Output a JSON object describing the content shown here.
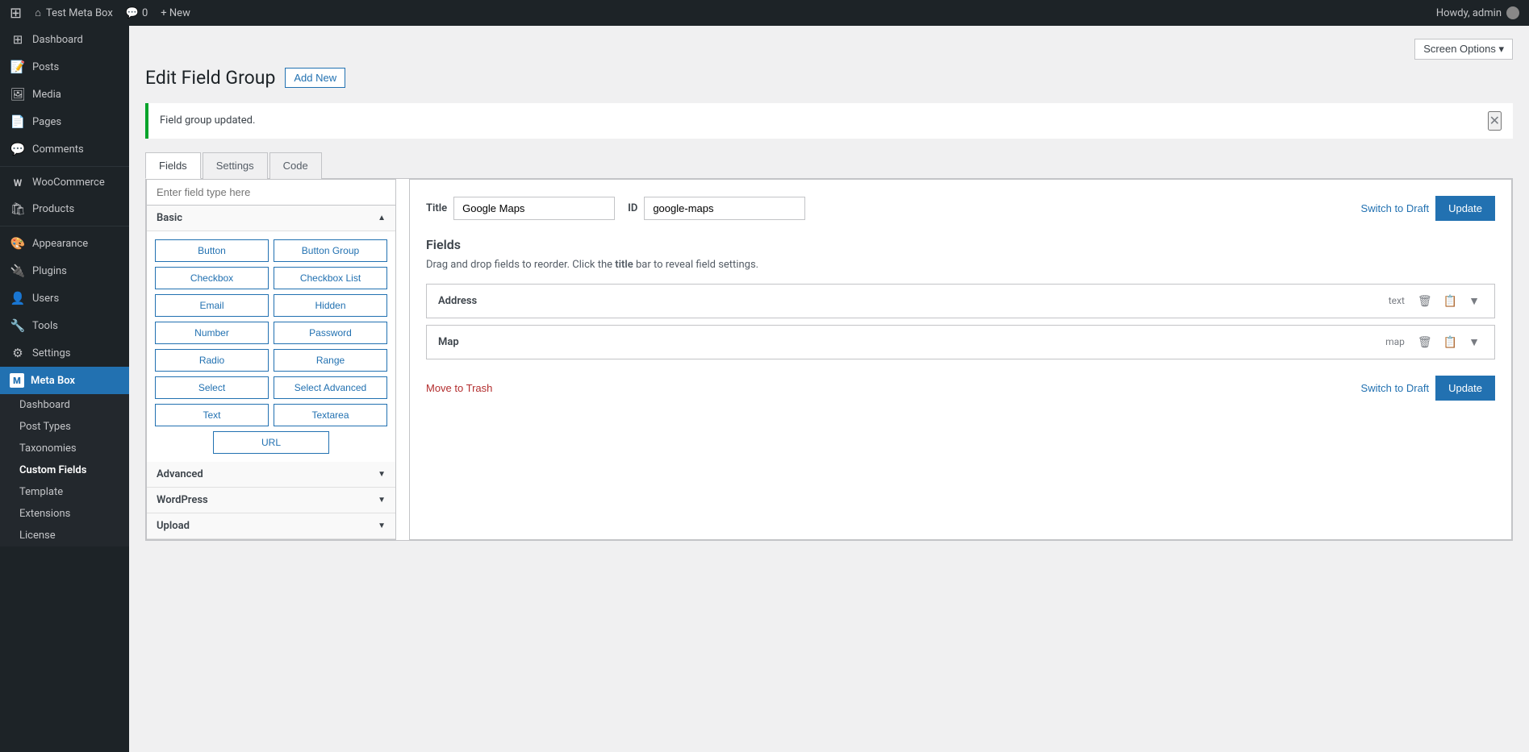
{
  "adminbar": {
    "wp_logo": "⊞",
    "site_name": "Test Meta Box",
    "home_icon": "⌂",
    "comments_icon": "💬",
    "comments_count": "0",
    "new_label": "+ New",
    "howdy": "Howdy, admin"
  },
  "sidebar": {
    "menu_items": [
      {
        "id": "dashboard",
        "label": "Dashboard",
        "icon": "⊞"
      },
      {
        "id": "posts",
        "label": "Posts",
        "icon": "📝"
      },
      {
        "id": "media",
        "label": "Media",
        "icon": "🖼"
      },
      {
        "id": "pages",
        "label": "Pages",
        "icon": "📄"
      },
      {
        "id": "comments",
        "label": "Comments",
        "icon": "💬"
      },
      {
        "id": "woocommerce",
        "label": "WooCommerce",
        "icon": "W"
      },
      {
        "id": "products",
        "label": "Products",
        "icon": "🛍"
      },
      {
        "id": "appearance",
        "label": "Appearance",
        "icon": "🎨"
      },
      {
        "id": "plugins",
        "label": "Plugins",
        "icon": "🔌"
      },
      {
        "id": "users",
        "label": "Users",
        "icon": "👤"
      },
      {
        "id": "tools",
        "label": "Tools",
        "icon": "🔧"
      },
      {
        "id": "settings",
        "label": "Settings",
        "icon": "⚙"
      }
    ],
    "metabox_label": "Meta Box",
    "metabox_m": "M",
    "submenu": [
      {
        "id": "mb-dashboard",
        "label": "Dashboard"
      },
      {
        "id": "post-types",
        "label": "Post Types"
      },
      {
        "id": "taxonomies",
        "label": "Taxonomies"
      },
      {
        "id": "custom-fields",
        "label": "Custom Fields",
        "active": true
      },
      {
        "id": "template",
        "label": "Template"
      },
      {
        "id": "extensions",
        "label": "Extensions"
      },
      {
        "id": "license",
        "label": "License"
      }
    ]
  },
  "screen_options": {
    "label": "Screen Options ▾"
  },
  "page": {
    "title": "Edit Field Group",
    "add_new_label": "Add New"
  },
  "notice": {
    "message": "Field group updated.",
    "close_icon": "✕"
  },
  "tabs": [
    {
      "id": "fields",
      "label": "Fields",
      "active": true
    },
    {
      "id": "settings",
      "label": "Settings"
    },
    {
      "id": "code",
      "label": "Code"
    }
  ],
  "field_type_search": {
    "placeholder": "Enter field type here"
  },
  "basic_section": {
    "label": "Basic",
    "expanded": true,
    "buttons": [
      {
        "id": "button",
        "label": "Button"
      },
      {
        "id": "button-group",
        "label": "Button Group"
      },
      {
        "id": "checkbox",
        "label": "Checkbox"
      },
      {
        "id": "checkbox-list",
        "label": "Checkbox List"
      },
      {
        "id": "email",
        "label": "Email"
      },
      {
        "id": "hidden",
        "label": "Hidden"
      },
      {
        "id": "number",
        "label": "Number"
      },
      {
        "id": "password",
        "label": "Password"
      },
      {
        "id": "radio",
        "label": "Radio"
      },
      {
        "id": "range",
        "label": "Range"
      },
      {
        "id": "select",
        "label": "Select"
      },
      {
        "id": "select-advanced",
        "label": "Select Advanced"
      },
      {
        "id": "text",
        "label": "Text"
      },
      {
        "id": "textarea",
        "label": "Textarea"
      },
      {
        "id": "url",
        "label": "URL",
        "full": true
      }
    ]
  },
  "advanced_section": {
    "label": "Advanced",
    "expanded": false
  },
  "wordpress_section": {
    "label": "WordPress",
    "expanded": false
  },
  "upload_section": {
    "label": "Upload",
    "expanded": false
  },
  "main_panel": {
    "title_label": "Title",
    "title_value": "Google Maps",
    "id_label": "ID",
    "id_value": "google-maps",
    "switch_draft_label": "Switch to Draft",
    "update_label": "Update",
    "fields_heading": "Fields",
    "fields_help": "Drag and drop fields to reorder. Click the title bar to reveal field settings.",
    "fields_help_bold": "title",
    "field_rows": [
      {
        "name": "Address",
        "type": "text"
      },
      {
        "name": "Map",
        "type": "map"
      }
    ],
    "move_trash_label": "Move to Trash"
  }
}
